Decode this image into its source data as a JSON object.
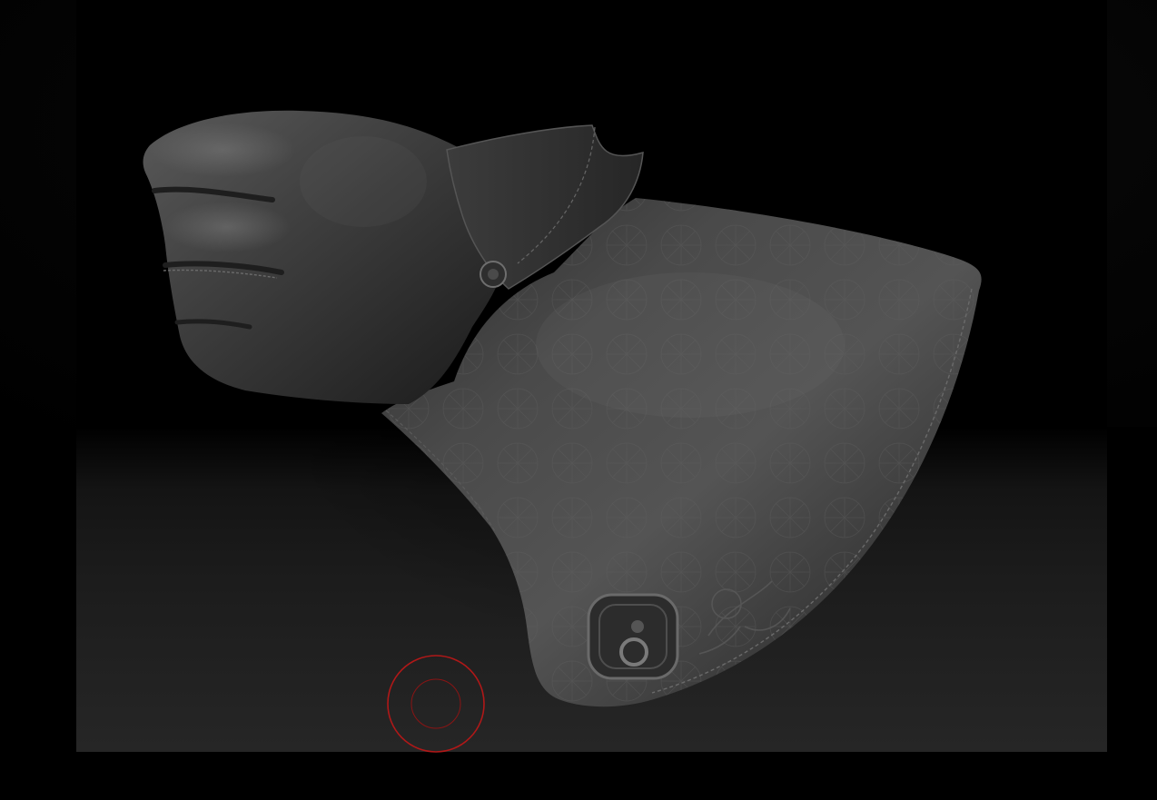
{
  "canvas": {
    "viewport_bg_bottom": "#262626",
    "outer_bg": "#000000"
  },
  "model": {
    "icon": "leather-gauntlet-sculpt",
    "base_color": "#3a3a3a",
    "highlight_color": "#6a6a6a",
    "shadow_color": "#121212"
  },
  "brush": {
    "icon": "brush-cursor-icon",
    "color": "#b01818"
  }
}
